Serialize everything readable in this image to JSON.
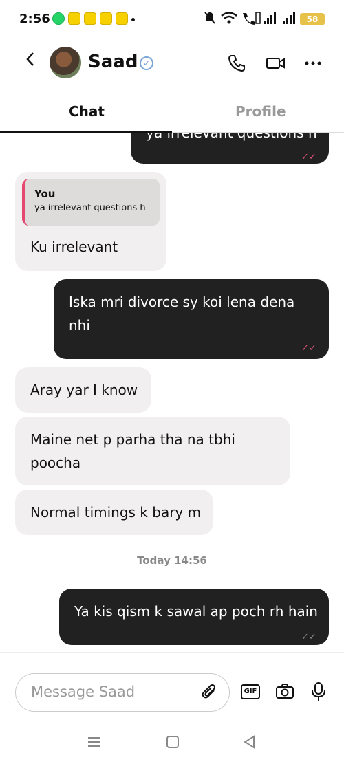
{
  "status_bar": {
    "time": "2:56",
    "battery": "58"
  },
  "header": {
    "contact_name": "Saad",
    "back_icon": "chevron-left-icon",
    "call_icon": "phone-icon",
    "video_icon": "video-camera-icon",
    "more_icon": "ellipsis-icon"
  },
  "tabs": {
    "chat": "Chat",
    "profile": "Profile"
  },
  "messages": {
    "m0": {
      "text": "ya irrelevant questions h",
      "direction": "out"
    },
    "m1": {
      "reply_author": "You",
      "reply_text": "ya irrelevant questions h",
      "text": "Ku irrelevant",
      "direction": "in"
    },
    "m2": {
      "line1": "Iska mri divorce sy koi lena dena",
      "line2": "nhi",
      "direction": "out"
    },
    "m3": {
      "text": "Aray yar I know",
      "direction": "in"
    },
    "m4": {
      "line1": "Maine net p parha tha na tbhi",
      "line2": "poocha",
      "direction": "in"
    },
    "m5": {
      "text": "Normal timings k bary m",
      "direction": "in"
    },
    "m6": {
      "text": "Ya kis qism k sawal ap poch rh hain",
      "direction": "out"
    }
  },
  "date_separator": "Today 14:56",
  "composer": {
    "placeholder": "Message Saad",
    "gif_label": "GIF"
  },
  "colors": {
    "outgoing_bubble": "#212121",
    "incoming_bubble": "#f1efef",
    "reply_accent": "#e5476e",
    "read_check": "#e0527a"
  }
}
